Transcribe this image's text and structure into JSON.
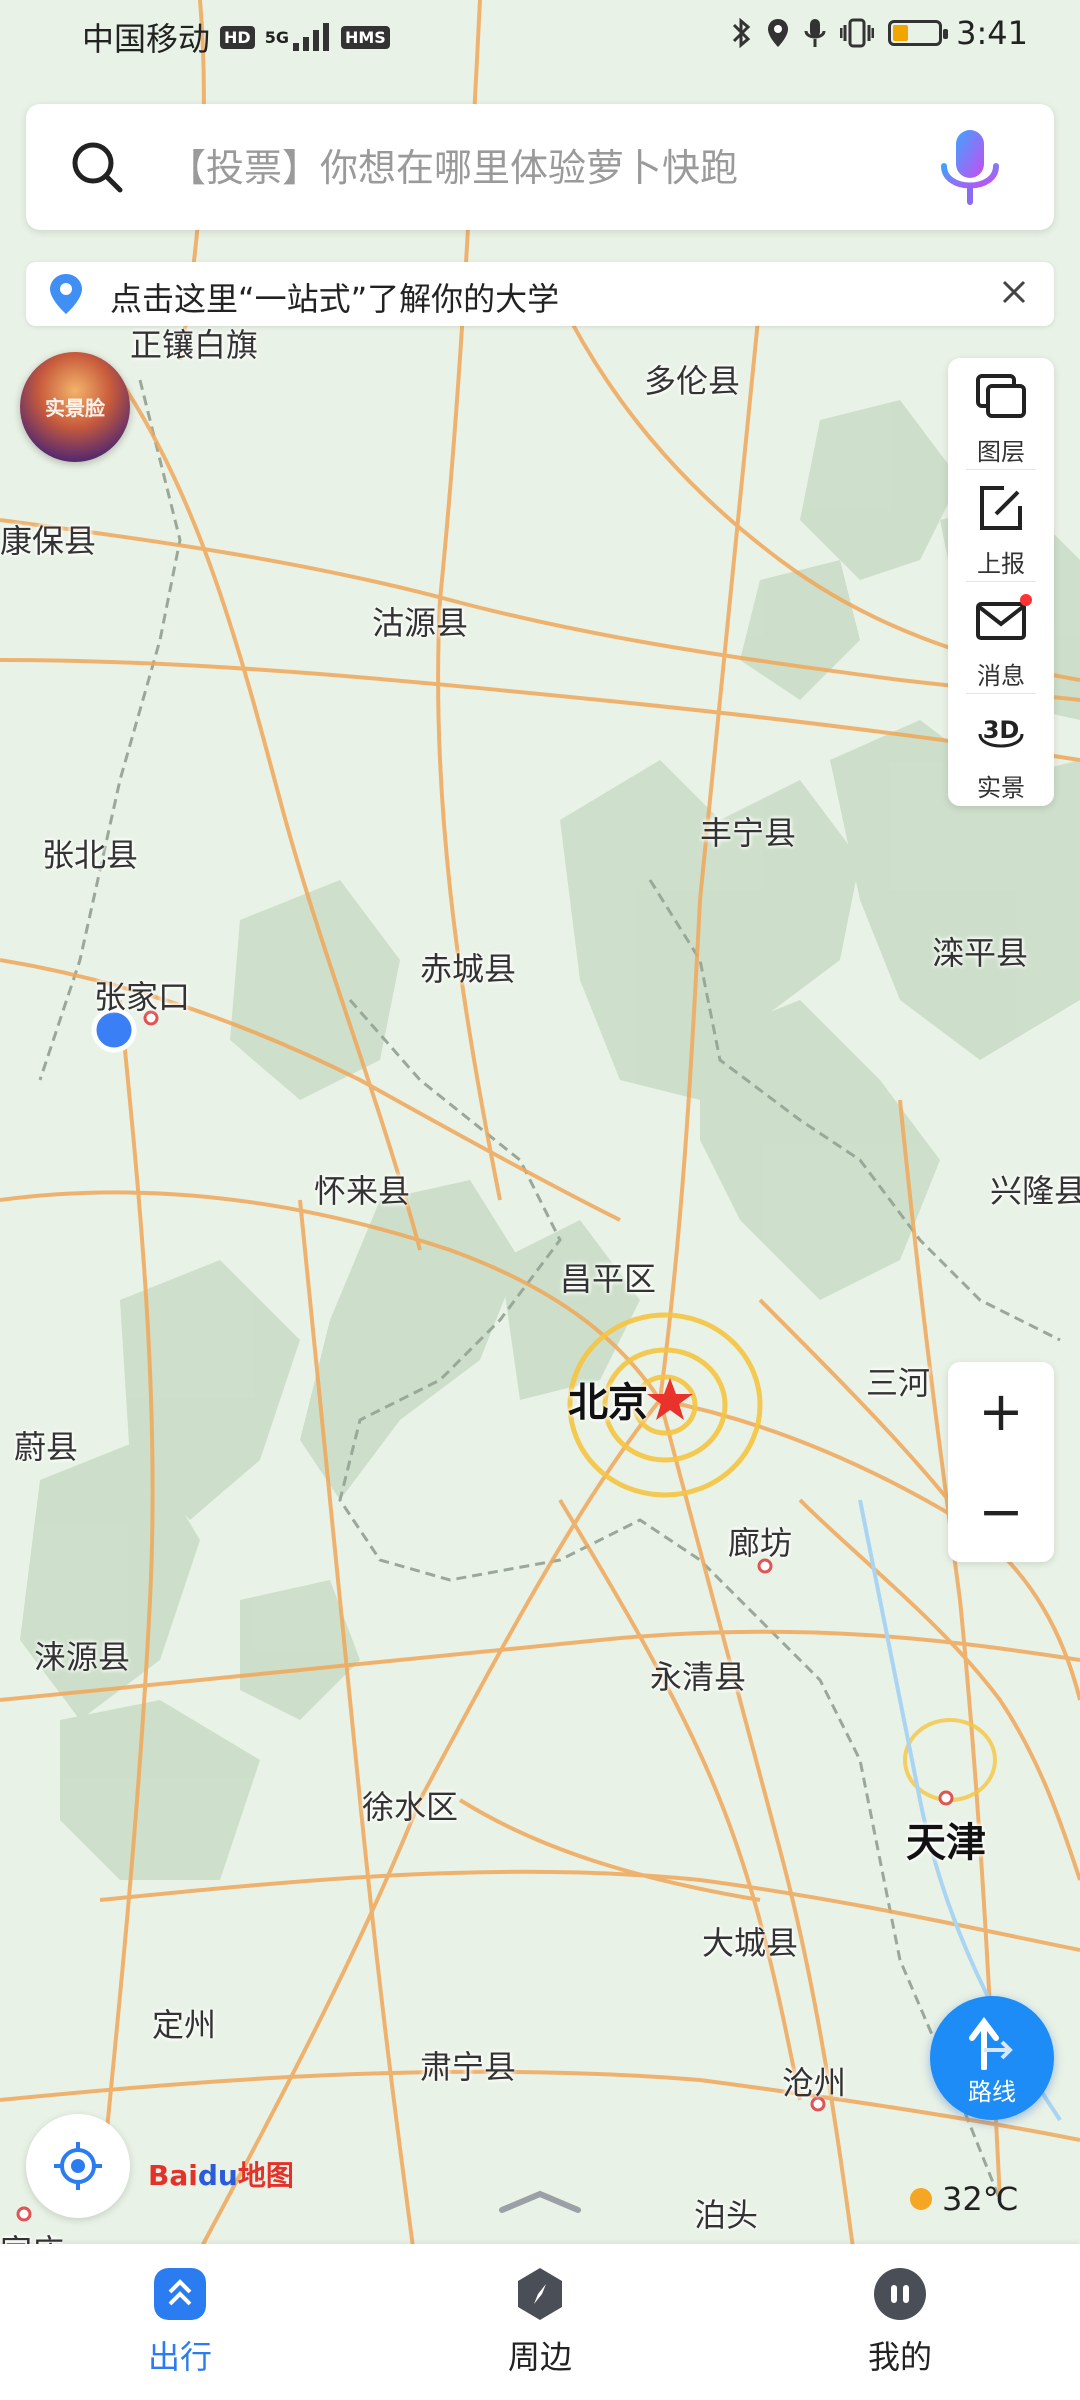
{
  "status_bar": {
    "carrier": "中国移动",
    "hd_badge": "HD",
    "network": "5G",
    "hms_badge": "HMS",
    "time": "3:41",
    "battery_level": 0.3
  },
  "search": {
    "placeholder": "【投票】你想在哪里体验萝卜快跑"
  },
  "notice": {
    "text": "点击这里“一站式”了解你的大学"
  },
  "avatar": {
    "label": "实景脸"
  },
  "tools": {
    "layers": "图层",
    "report": "上报",
    "messages": "消息",
    "realview": "实景",
    "realview_icon_text": "3D"
  },
  "zoom": {
    "in": "+",
    "out": "−"
  },
  "route_button": {
    "label": "路线"
  },
  "map_labels": {
    "zhengxiangbaiqi": "正镶白旗",
    "duolun": "多伦县",
    "kangbao": "康保县",
    "guyuan": "沽源县",
    "zhangbei": "张北县",
    "fengning": "丰宁县",
    "luanping": "滦平县",
    "zhangjiakou": "张家口",
    "chicheng": "赤城县",
    "huailai": "怀来县",
    "xinglong": "兴隆县",
    "changping": "昌平区",
    "beijing": "北京",
    "sanhe": "三河",
    "yuxian": "蔚县",
    "langfang": "廊坊",
    "laiyuan": "涞源县",
    "yongqing": "永清县",
    "xushui": "徐水区",
    "tianjin": "天津",
    "dacheng": "大城县",
    "dingzhou": "定州",
    "suning": "肃宁县",
    "cangzhou": "沧州",
    "botou": "泊头",
    "shijiazhuang": "家庄"
  },
  "logo": {
    "bai": "Bai",
    "du": "du",
    "ditu": "地图"
  },
  "weather": {
    "temperature": "32℃"
  },
  "bottom_nav": {
    "travel": "出行",
    "nearby": "周边",
    "mine": "我的"
  },
  "colors": {
    "accent": "#2a7cf0",
    "route_button": "#1e8cf6",
    "road": "#f0a85a",
    "map_bg": "#e9f2e6",
    "forest": "#c9dcc6"
  }
}
